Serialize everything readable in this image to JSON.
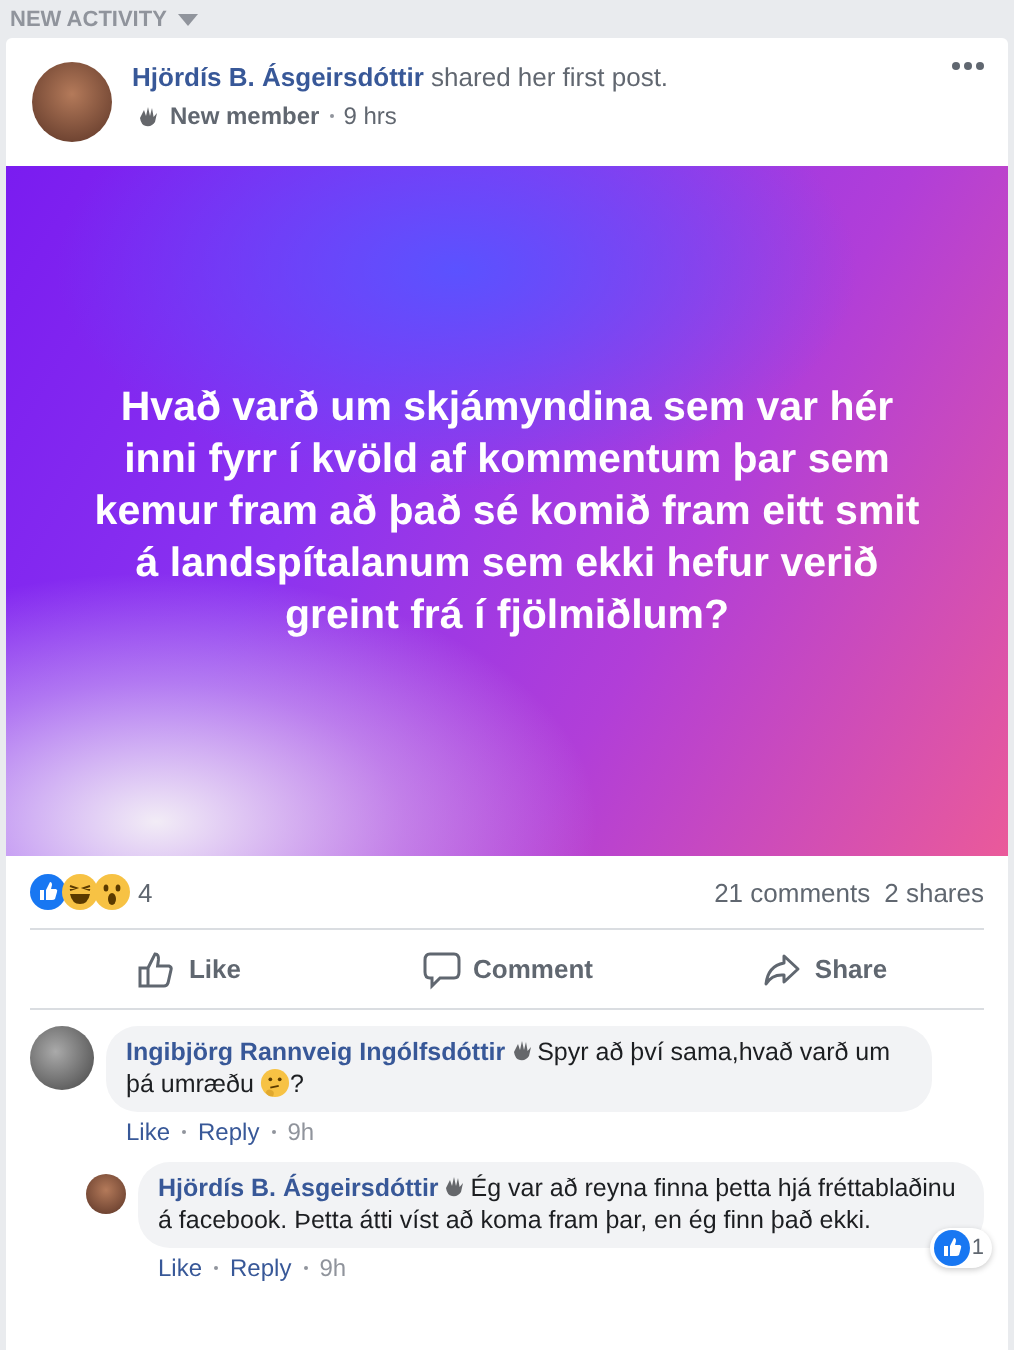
{
  "section_header": {
    "label": "NEW ACTIVITY"
  },
  "post": {
    "author": "Hjördís B. Ásgeirsdóttir",
    "action": "shared her first post.",
    "badge": "New member",
    "time": "9 hrs",
    "text": "Hvað varð um skjámyndina sem var hér inni fyrr í kvöld af kommentum þar sem kemur fram að það sé komið fram eitt smit á landspítalanum sem ekki hefur verið greint frá í fjölmiðlum?",
    "reactions": {
      "icons": [
        {
          "kind": "like"
        },
        {
          "kind": "haha"
        },
        {
          "kind": "wow"
        }
      ],
      "count": "4"
    },
    "comments_count": "21 comments",
    "shares_count": "2 shares",
    "actions": [
      {
        "kind": "like",
        "label": "Like"
      },
      {
        "kind": "comment",
        "label": "Comment"
      },
      {
        "kind": "share",
        "label": "Share"
      }
    ]
  },
  "comments": [
    {
      "author": "Ingibjörg Rannveig Ingólfsdóttir",
      "text": "Spyr að því sama,hvað varð um þá umræðu",
      "emoji": {
        "kind": "thinking"
      },
      "text_end": "?",
      "like": "Like",
      "reply": "Reply",
      "time": "9h",
      "replies": [
        {
          "author": "Hjördís B. Ásgeirsdóttir",
          "text": "Ég var að reyna finna þetta hjá fréttablaðinu á facebook. Þetta átti víst að koma fram þar, en ég finn það ekki.",
          "like": "Like",
          "reply": "Reply",
          "time": "9h",
          "reaction_count": "1"
        }
      ]
    }
  ]
}
